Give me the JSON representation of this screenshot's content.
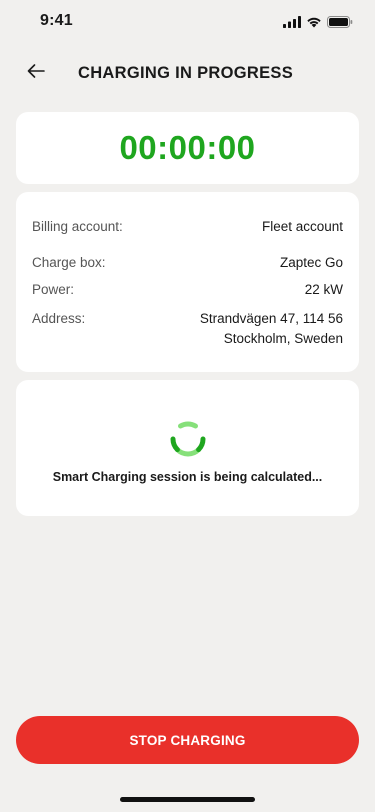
{
  "status_bar": {
    "time": "9:41",
    "icons": [
      "signal-icon",
      "wifi-icon",
      "battery-icon"
    ]
  },
  "header": {
    "back_icon": "arrow-left-icon",
    "title": "CHARGING IN PROGRESS"
  },
  "timer": {
    "value": "00:00:00",
    "color": "#1fa61f"
  },
  "details": {
    "billing_account": {
      "label": "Billing account:",
      "value": "Fleet account"
    },
    "charge_box": {
      "label": "Charge box:",
      "value": "Zaptec Go"
    },
    "power": {
      "label": "Power:",
      "value": "22 kW"
    },
    "address": {
      "label": "Address:",
      "value_line1": "Strandvägen 47, 114 56",
      "value_line2": "Stockholm, Sweden"
    }
  },
  "calculation": {
    "spinner_icon": "loading-spinner-icon",
    "message": "Smart Charging session is being calculated...",
    "spinner_colors": [
      "#1fa61f",
      "#86e07a"
    ]
  },
  "actions": {
    "stop_label": "STOP CHARGING",
    "stop_color": "#e9302a"
  }
}
